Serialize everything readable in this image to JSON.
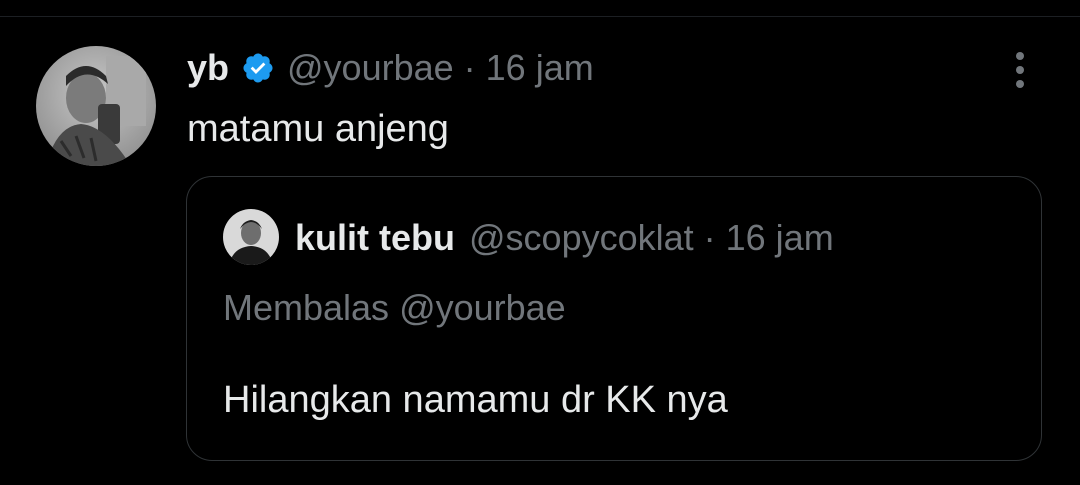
{
  "tweet": {
    "display_name": "yb",
    "verified_icon": "verified-badge-icon",
    "verified_color": "#1d9bf0",
    "handle": "@yourbae",
    "separator": "·",
    "time": "16 jam",
    "text": "matamu anjeng",
    "more_icon": "more-vertical-icon"
  },
  "quote": {
    "display_name": "kulit tebu",
    "handle": "@scopycoklat",
    "separator": "·",
    "time": "16 jam",
    "reply_context": "Membalas @yourbae",
    "text": "Hilangkan namamu dr KK nya"
  },
  "colors": {
    "background": "#000000",
    "primary_text": "#e7e9ea",
    "secondary_text": "#71767b",
    "border": "#2f3336"
  }
}
